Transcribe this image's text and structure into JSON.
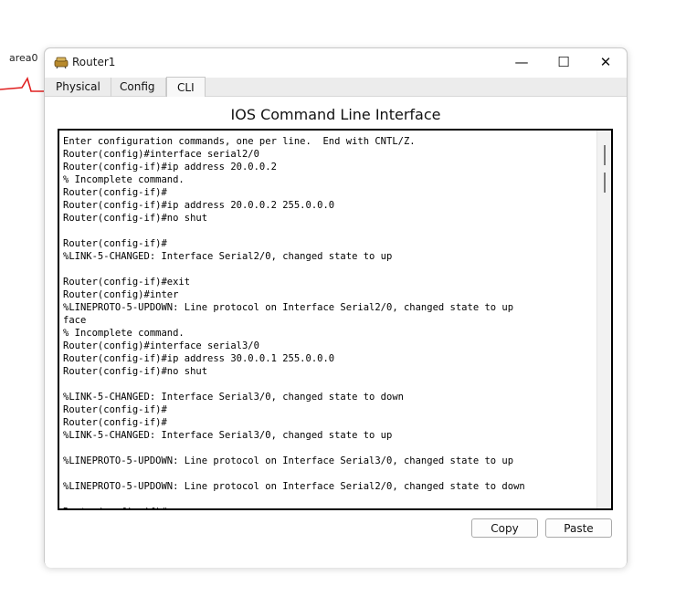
{
  "background": {
    "area_label": "area0",
    "link_color": "#e02020"
  },
  "window": {
    "title": "Router1",
    "controls": {
      "minimize": "—",
      "maximize": "☐",
      "close": "✕"
    }
  },
  "tabs": [
    {
      "label": "Physical"
    },
    {
      "label": "Config"
    },
    {
      "label": "CLI"
    }
  ],
  "cli": {
    "heading": "IOS Command Line Interface",
    "lines": [
      "Enter configuration commands, one per line.  End with CNTL/Z.",
      "Router(config)#interface serial2/0",
      "Router(config-if)#ip address 20.0.0.2",
      "% Incomplete command.",
      "Router(config-if)#",
      "Router(config-if)#ip address 20.0.0.2 255.0.0.0",
      "Router(config-if)#no shut",
      "",
      "Router(config-if)#",
      "%LINK-5-CHANGED: Interface Serial2/0, changed state to up",
      "",
      "Router(config-if)#exit",
      "Router(config)#inter",
      "%LINEPROTO-5-UPDOWN: Line protocol on Interface Serial2/0, changed state to up",
      "face",
      "% Incomplete command.",
      "Router(config)#interface serial3/0",
      "Router(config-if)#ip address 30.0.0.1 255.0.0.0",
      "Router(config-if)#no shut",
      "",
      "%LINK-5-CHANGED: Interface Serial3/0, changed state to down",
      "Router(config-if)#",
      "Router(config-if)#",
      "%LINK-5-CHANGED: Interface Serial3/0, changed state to up",
      "",
      "%LINEPROTO-5-UPDOWN: Line protocol on Interface Serial3/0, changed state to up",
      "",
      "%LINEPROTO-5-UPDOWN: Line protocol on Interface Serial2/0, changed state to down",
      "",
      "Router(config-if)#"
    ]
  },
  "buttons": {
    "copy": "Copy",
    "paste": "Paste"
  }
}
